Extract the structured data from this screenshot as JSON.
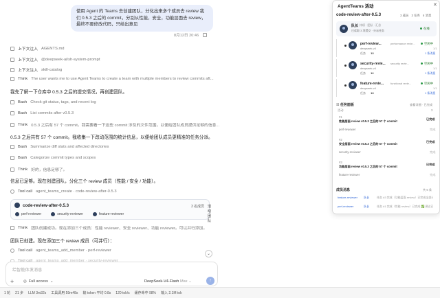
{
  "user_message": {
    "text": "使用 Agent 的 Teams 去创建团队，分化出来多个成员去 review 我们 0.5.3 之后的 commit，分别从性能，安全，功能层面去 review，最终不要修改代码，只给出意见",
    "time": "8月12日 20:46"
  },
  "transcript": {
    "ctx1_label": "上下文注入",
    "ctx1_value": "AGENTS.md",
    "ctx2_label": "上下文注入",
    "ctx2_value": "@deepseek-ai/sh-system-prompt",
    "ctx3_label": "上下文注入",
    "ctx3_value": "skill-catalog",
    "think1_label": "Think",
    "think1_value": "The user wants me to use Agent Teams to create a team with multiple members to review commits aft...",
    "msg1": "我先了解一下仓库中 0.5.3 之后的提交情况，再创建团队。",
    "bash1_label": "Bash",
    "bash1_value": "Check git status, tags, and recent log",
    "bash2_label": "Bash",
    "bash2_value": "List commits after v0.5.3",
    "think2_label": "Think",
    "think2_value": "0.5.3 之后有 57 个 commit。我需要看一下这些 commit 涉及的文件范围，以便给团队成员提供足够的信息...",
    "msg2": "0.5.3 之后共有 57 个 commit。我收集一下改动范围的统计信息，以便给团队成员更精准的任务分派。",
    "bash3_label": "Bash",
    "bash3_value": "Summarize diff stats and affected directories",
    "bash4_label": "Bash",
    "bash4_value": "Categorize commit types and scopes",
    "think3_label": "Think",
    "think3_value": "好的，信息足够了。",
    "msg3": "信息已足够。现在创建团队，分化三个 review 成员（性能 / 安全 / 功能）。",
    "tool1_label": "Tool call",
    "tool1_value": "agent_teams_create · code-review-after-0.5.3",
    "team_card": {
      "title": "code-review-after-0.5.3",
      "count": "3 名成员",
      "status": "活动团队",
      "members": [
        "perf-reviewer",
        "security-reviewer",
        "feature-reviewer"
      ]
    },
    "think4_label": "Think",
    "think4_value": "团队创建成功。现在添加三个成员：性能 reviewer、安全 reviewer、功能 reviewer。可以并行添加。",
    "msg4": "团队已创建。现在添加三个 review 成员（可并行）：",
    "tool2_label": "Tool call",
    "tool2_value": "agent_teams_add_member · perf-reviewer",
    "tool3_label": "Tool call",
    "tool3_value": "agent_teams_add_member · security-reviewer"
  },
  "input": {
    "placeholder": "给智能体发消息",
    "access": "Full access",
    "model": "DeepSeek-V4-Flash",
    "model_sub": "Max"
  },
  "status_bar": [
    "1 轮",
    "21 步",
    "LLM 3m32s",
    "工具调用 59m48s",
    "输 token 平均 0.8s",
    "120 tok/s",
    "缓存命中 98%",
    "输入 2.1M tok"
  ],
  "panel": {
    "title": "AgentTeams 活动",
    "team": "code-review-after-0.5.3",
    "stats": [
      "3 成员",
      "3 任务",
      "6 消息"
    ],
    "lead": {
      "name": "队长",
      "tabs": "持续 · 团队 · 汇总",
      "desc": "已读取 3 项提交 · 分派任务",
      "status": "在线"
    },
    "members": [
      {
        "name": "perf-review...",
        "role": "performance revie...",
        "status": "空闲中",
        "model": "deepseek-v4",
        "ratio": "1/1",
        "tasks": "13",
        "more": "1 条消息"
      },
      {
        "name": "security-revie...",
        "role": "security revie...",
        "status": "空闲中",
        "model": "deepseek-v4",
        "ratio": "1/1",
        "tasks": "12",
        "more": "1 条消息"
      },
      {
        "name": "feature-revie...",
        "role": "functional revie...",
        "status": "空闲中",
        "model": "deepseek-v4",
        "ratio": "1/1",
        "tasks": "13",
        "more": "1 条消息"
      }
    ],
    "task_header": "任务面板",
    "task_header_right": "查看详细 · 已完成",
    "task_sub_left": "活动",
    "task_sub_right": "3",
    "tasks": [
      {
        "num": "#1",
        "title": "性能层面 review v0.5.3 之后的 57 个 commit",
        "status": "已完成",
        "owner": "perf-reviewer",
        "date": "完成"
      },
      {
        "num": "#2",
        "title": "安全层面 review v0.5.3 之后的 57 个 commit",
        "status": "已完成",
        "owner": "security-reviewer",
        "date": "完成"
      },
      {
        "num": "#3",
        "title": "功能层面 review v0.5.3 之后的 57 个 commit",
        "status": "已完成",
        "owner": "feature-reviewer",
        "date": "完成"
      }
    ],
    "msg_header": "成员消息",
    "msg_header_right": "共 6 条",
    "messages": [
      {
        "from": "feature-reviewer",
        "to": "队长",
        "body": "任务 #3 完成（功能层面 review）已完成全部分析..."
      },
      {
        "from": "perf-reviewer",
        "to": "队长",
        "body": "任务 #1 完成（性能 review）已完成 ✅ 建议已发出..."
      }
    ]
  }
}
